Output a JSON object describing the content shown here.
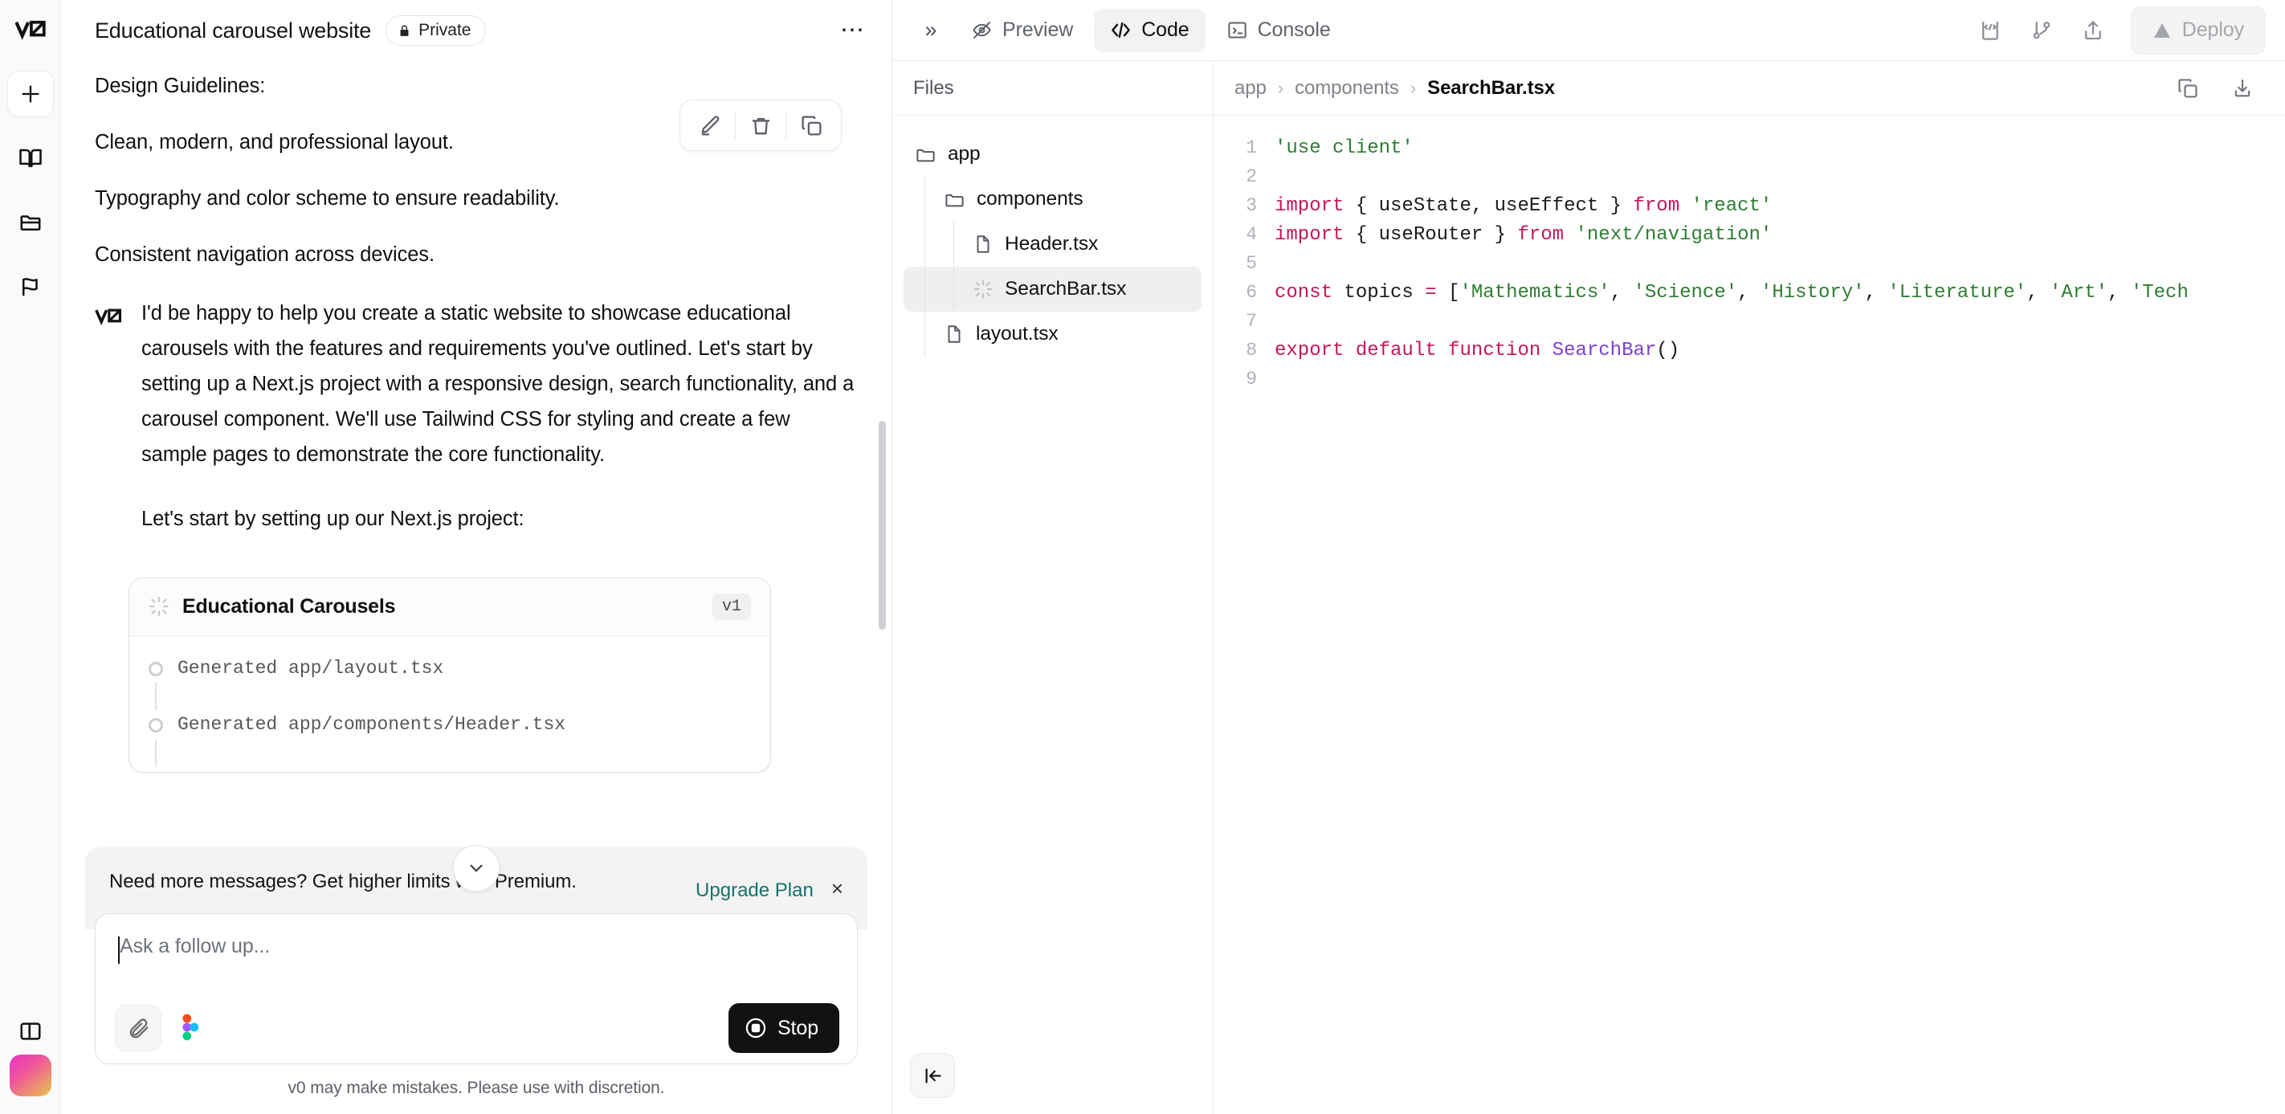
{
  "rail": {
    "logo": "v0-logo",
    "items": [
      {
        "name": "new-chat",
        "icon": "plus-icon"
      },
      {
        "name": "library",
        "icon": "book-icon"
      },
      {
        "name": "projects",
        "icon": "folder-icon"
      },
      {
        "name": "feedback",
        "icon": "flag-icon"
      }
    ],
    "toggle_icon": "sidebar-toggle-icon",
    "avatar": "user-avatar"
  },
  "chat": {
    "title": "Educational carousel website",
    "privacy_badge": "Private",
    "menu_icon": "more-horizontal-icon",
    "hover_tools": [
      {
        "name": "edit-message-button",
        "icon": "pencil-icon"
      },
      {
        "name": "delete-message-button",
        "icon": "trash-icon"
      },
      {
        "name": "copy-message-button",
        "icon": "copy-icon"
      }
    ],
    "user_message": {
      "lines": [
        "Design Guidelines:",
        "Clean, modern, and professional layout.",
        "Typography and color scheme to ensure readability.",
        "Consistent navigation across devices."
      ]
    },
    "ai_message": {
      "paragraphs": [
        "I'd be happy to help you create a static website to showcase educational carousels with the features and requirements you've outlined. Let's start by setting up a Next.js project with a responsive design, search functionality, and a carousel component. We'll use Tailwind CSS for styling and create a few sample pages to demonstrate the core functionality.",
        "Let's start by setting up our Next.js project:"
      ]
    },
    "version_card": {
      "title": "Educational Carousels",
      "version": "v1",
      "status_icon": "loading-spinner-icon",
      "steps": [
        "Generated app/layout.tsx",
        "Generated app/components/Header.tsx"
      ]
    },
    "scroll_down_icon": "chevron-down-icon"
  },
  "upgrade_banner": {
    "text": "Need more messages? Get higher limits with Premium.",
    "link": "Upgrade Plan",
    "close_icon": "close-icon",
    "link_color": "#16726a"
  },
  "composer": {
    "placeholder": "Ask a follow up...",
    "value": "",
    "attach_icon": "paperclip-icon",
    "figma_icon": "figma-icon",
    "stop_label": "Stop",
    "stop_icon": "stop-circle-icon",
    "disclaimer": "v0 may make mistakes. Please use with discretion."
  },
  "right_panel": {
    "expand_icon": "chevrons-right-icon",
    "tabs": [
      {
        "label": "Preview",
        "icon": "eye-off-icon",
        "active": false
      },
      {
        "label": "Code",
        "icon": "code-icon",
        "active": true
      },
      {
        "label": "Console",
        "icon": "terminal-icon",
        "active": false
      }
    ],
    "actions": [
      {
        "name": "embed-button",
        "icon": "code-block-icon"
      },
      {
        "name": "branch-button",
        "icon": "git-branch-icon"
      },
      {
        "name": "share-button",
        "icon": "share-icon"
      }
    ],
    "deploy_label": "Deploy",
    "deploy_icon": "vercel-triangle-icon"
  },
  "files": {
    "header": "Files",
    "collapse_icon": "collapse-left-icon",
    "tree": [
      {
        "label": "app",
        "type": "folder",
        "depth": 1,
        "selected": false,
        "icon": "folder-icon"
      },
      {
        "label": "components",
        "type": "folder",
        "depth": 2,
        "selected": false,
        "icon": "folder-icon"
      },
      {
        "label": "Header.tsx",
        "type": "file",
        "depth": 3,
        "selected": false,
        "icon": "file-icon"
      },
      {
        "label": "SearchBar.tsx",
        "type": "file",
        "depth": 3,
        "selected": true,
        "icon": "loading-spinner-icon"
      },
      {
        "label": "layout.tsx",
        "type": "file",
        "depth": 2,
        "selected": false,
        "icon": "file-icon"
      }
    ]
  },
  "editor": {
    "breadcrumb": [
      "app",
      "components",
      "SearchBar.tsx"
    ],
    "breadcrumb_separator": "›",
    "actions": [
      {
        "name": "copy-code-button",
        "icon": "copy-icon"
      },
      {
        "name": "download-code-button",
        "icon": "download-icon"
      }
    ],
    "lines": [
      {
        "n": "1",
        "tokens": [
          {
            "t": "'use client'",
            "c": "s"
          }
        ]
      },
      {
        "n": "2",
        "tokens": []
      },
      {
        "n": "3",
        "tokens": [
          {
            "t": "import",
            "c": "k"
          },
          {
            "t": " { useState, useEffect } ",
            "c": "p"
          },
          {
            "t": "from",
            "c": "k"
          },
          {
            "t": " ",
            "c": "p"
          },
          {
            "t": "'react'",
            "c": "s"
          }
        ]
      },
      {
        "n": "4",
        "tokens": [
          {
            "t": "import",
            "c": "k"
          },
          {
            "t": " { useRouter } ",
            "c": "p"
          },
          {
            "t": "from",
            "c": "k"
          },
          {
            "t": " ",
            "c": "p"
          },
          {
            "t": "'next/navigation'",
            "c": "s"
          }
        ]
      },
      {
        "n": "5",
        "tokens": []
      },
      {
        "n": "6",
        "tokens": [
          {
            "t": "const",
            "c": "k"
          },
          {
            "t": " topics ",
            "c": "p"
          },
          {
            "t": "=",
            "c": "k"
          },
          {
            "t": " [",
            "c": "p"
          },
          {
            "t": "'Mathematics'",
            "c": "s"
          },
          {
            "t": ", ",
            "c": "p"
          },
          {
            "t": "'Science'",
            "c": "s"
          },
          {
            "t": ", ",
            "c": "p"
          },
          {
            "t": "'History'",
            "c": "s"
          },
          {
            "t": ", ",
            "c": "p"
          },
          {
            "t": "'Literature'",
            "c": "s"
          },
          {
            "t": ", ",
            "c": "p"
          },
          {
            "t": "'Art'",
            "c": "s"
          },
          {
            "t": ", ",
            "c": "p"
          },
          {
            "t": "'Tech",
            "c": "s"
          }
        ]
      },
      {
        "n": "7",
        "tokens": []
      },
      {
        "n": "8",
        "tokens": [
          {
            "t": "export default function",
            "c": "k"
          },
          {
            "t": " ",
            "c": "p"
          },
          {
            "t": "SearchBar",
            "c": "f"
          },
          {
            "t": "()",
            "c": "p"
          }
        ]
      },
      {
        "n": "9",
        "tokens": []
      }
    ]
  }
}
